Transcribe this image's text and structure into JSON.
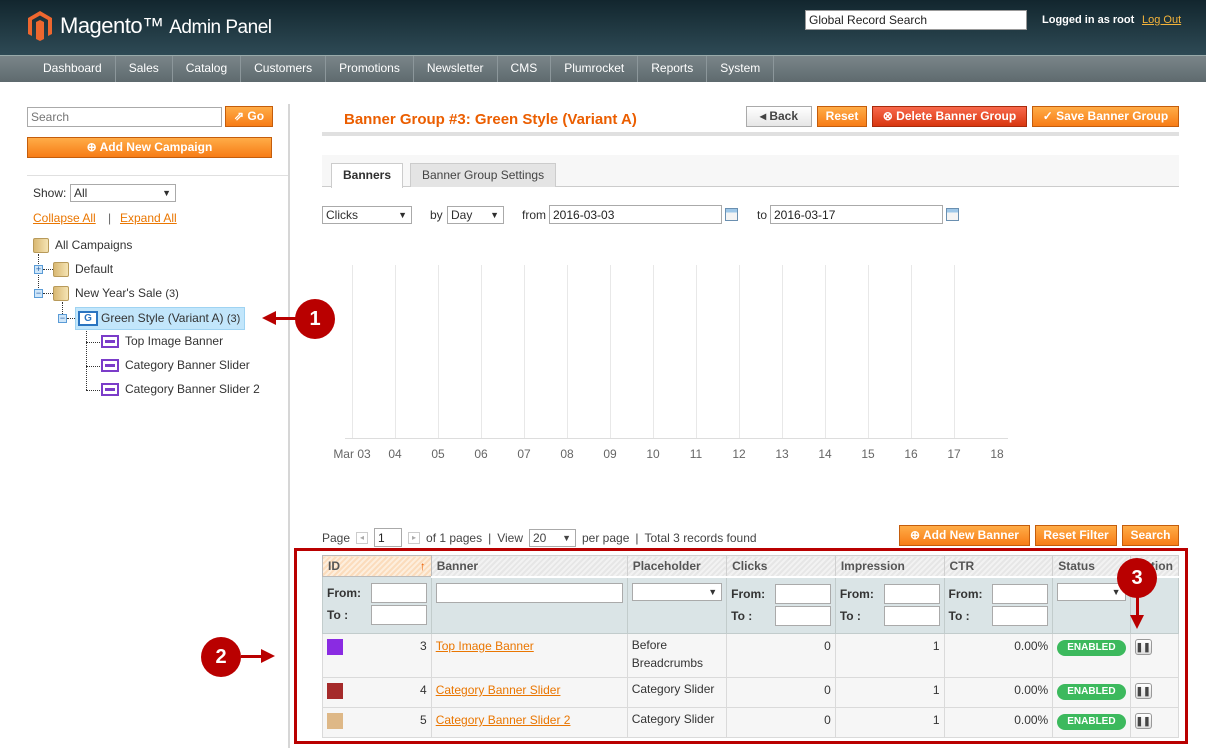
{
  "header": {
    "logo": "Magento",
    "logo_suffix": "Admin Panel",
    "global_search_value": "Global Record Search",
    "logged_in": "Logged in as root",
    "logout": "Log Out"
  },
  "nav": [
    "Dashboard",
    "Sales",
    "Catalog",
    "Customers",
    "Promotions",
    "Newsletter",
    "CMS",
    "Plumrocket",
    "Reports",
    "System"
  ],
  "sidebar": {
    "search_placeholder": "Search",
    "go": "Go",
    "add_campaign": "Add New Campaign",
    "show_label": "Show:",
    "show_value": "All",
    "collapse_all": "Collapse All",
    "expand_all": "Expand All",
    "tree": {
      "root": "All Campaigns",
      "default": "Default",
      "new_year": "New Year's Sale",
      "new_year_count": "(3)",
      "green": "Green Style (Variant A)",
      "green_count": "(3)",
      "banners": [
        "Top Image Banner",
        "Category Banner Slider",
        "Category Banner Slider 2"
      ]
    }
  },
  "page": {
    "title": "Banner Group #3: Green Style (Variant A)",
    "back": "Back",
    "reset": "Reset",
    "delete": "Delete Banner Group",
    "save": "Save Banner Group",
    "tabs": [
      "Banners",
      "Banner Group Settings"
    ],
    "active_tab": "Banners"
  },
  "stats": {
    "metric": "Clicks",
    "by_label": "by",
    "period": "Day",
    "from_label": "from",
    "from": "2016-03-03",
    "to_label": "to",
    "to": "2016-03-17",
    "x_labels": [
      "Mar 03",
      "04",
      "05",
      "06",
      "07",
      "08",
      "09",
      "10",
      "11",
      "12",
      "13",
      "14",
      "15",
      "16",
      "17",
      "18"
    ]
  },
  "grid": {
    "page_label": "Page",
    "page": "1",
    "of_pages": "of 1 pages",
    "view_label": "View",
    "per_page": "20",
    "per_page_label": "per page",
    "total": "Total 3 records found",
    "add_banner": "Add New Banner",
    "reset_filter": "Reset Filter",
    "search": "Search",
    "columns": [
      "ID",
      "Banner",
      "Placeholder",
      "Clicks",
      "Impression",
      "CTR",
      "Status",
      "Action"
    ],
    "from": "From:",
    "to": "To :",
    "rows": [
      {
        "color": "#8a2be2",
        "id": "3",
        "banner": "Top Image Banner",
        "placeholder": "Before Breadcrumbs",
        "clicks": "0",
        "impression": "1",
        "ctr": "0.00%",
        "status": "ENABLED"
      },
      {
        "color": "#a52a2a",
        "id": "4",
        "banner": "Category Banner Slider",
        "placeholder": "Category Slider",
        "clicks": "0",
        "impression": "1",
        "ctr": "0.00%",
        "status": "ENABLED"
      },
      {
        "color": "#deb887",
        "id": "5",
        "banner": "Category Banner Slider 2",
        "placeholder": "Category Slider",
        "clicks": "0",
        "impression": "1",
        "ctr": "0.00%",
        "status": "ENABLED"
      }
    ]
  },
  "callouts": [
    "1",
    "2",
    "3"
  ]
}
